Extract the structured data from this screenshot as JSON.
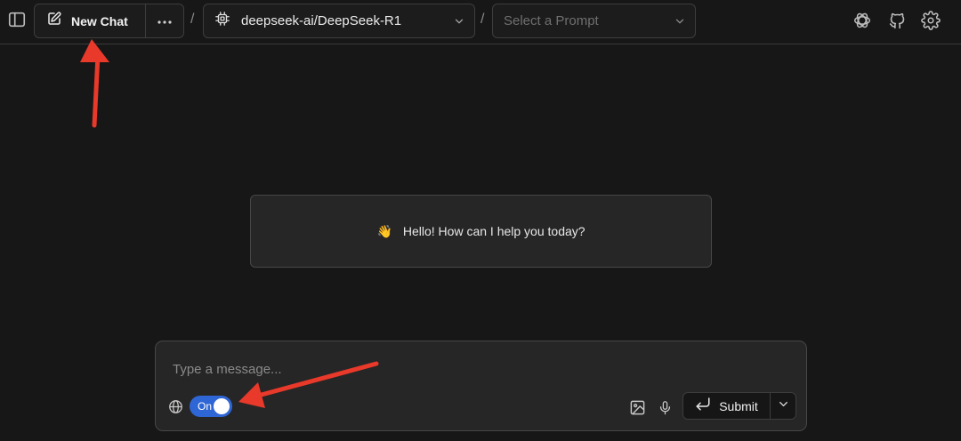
{
  "header": {
    "new_chat_label": "New Chat",
    "model_label": "deepseek-ai/DeepSeek-R1",
    "breadcrumb_separator": "/",
    "prompt_placeholder": "Select a Prompt"
  },
  "greeting": {
    "emoji": "👋",
    "text": "Hello! How can I help you today?"
  },
  "composer": {
    "placeholder": "Type a message...",
    "value": "",
    "web_search_toggle": {
      "label": "On",
      "enabled": true
    },
    "submit_label": "Submit"
  },
  "icons": {
    "sidebar": "sidebar-toggle-icon",
    "new_chat": "edit-icon",
    "more": "more-horizontal-icon",
    "model": "cpu-chip-icon",
    "openai": "openai-icon",
    "github": "github-icon",
    "settings": "gear-icon",
    "globe": "globe-icon",
    "image": "image-icon",
    "mic": "microphone-icon",
    "submit": "enter-icon",
    "submit_menu": "chevron-down-icon"
  },
  "colors": {
    "background": "#171717",
    "card": "#262626",
    "toggle_on": "#2f66d6",
    "annotation": "#e8392a"
  }
}
